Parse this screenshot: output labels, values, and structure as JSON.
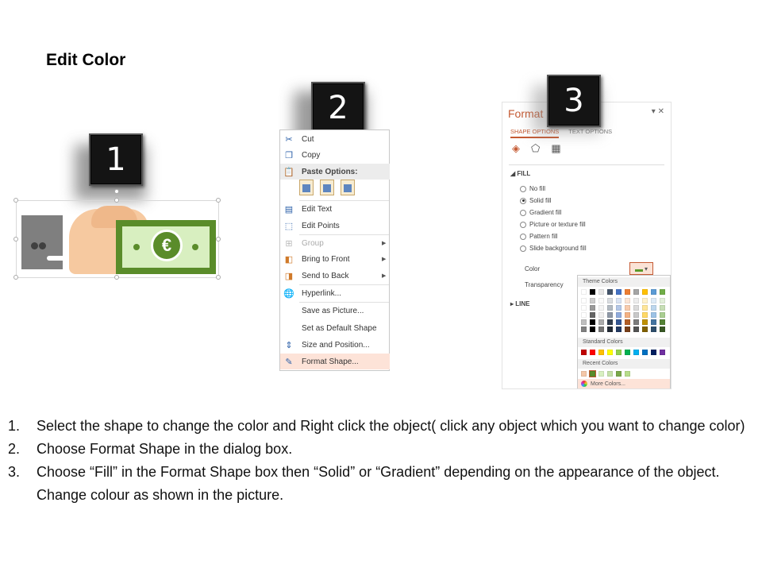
{
  "title": "Edit Color",
  "badges": [
    "1",
    "2",
    "3"
  ],
  "panel1": {
    "currency_symbol": "€"
  },
  "context_menu": {
    "items": [
      {
        "label": "Cut",
        "icon": "scissors-icon"
      },
      {
        "label": "Copy",
        "icon": "copy-icon"
      },
      {
        "label": "Paste Options:",
        "icon": "paste-icon"
      },
      {
        "label": "Edit Text",
        "icon": "edit-text-icon"
      },
      {
        "label": "Edit Points",
        "icon": "edit-points-icon"
      },
      {
        "label": "Group",
        "icon": "group-icon"
      },
      {
        "label": "Bring to Front",
        "icon": "bring-front-icon"
      },
      {
        "label": "Send to Back",
        "icon": "send-back-icon"
      },
      {
        "label": "Hyperlink...",
        "icon": "globe-link-icon"
      },
      {
        "label": "Save as Picture...",
        "icon": ""
      },
      {
        "label": "Set as Default Shape",
        "icon": ""
      },
      {
        "label": "Size and Position...",
        "icon": "size-position-icon"
      },
      {
        "label": "Format Shape...",
        "icon": "format-shape-icon"
      }
    ]
  },
  "format_pane": {
    "title": "Format",
    "tab_active": "SHAPE OPTIONS",
    "tab_other": "TEXT OPTIONS",
    "fill_section": "FILL",
    "fill_options": [
      "No fill",
      "Solid fill",
      "Gradient fill",
      "Picture or texture fill",
      "Pattern fill",
      "Slide background fill"
    ],
    "selected_fill": "Solid fill",
    "color_label": "Color",
    "transparency_label": "Transparency",
    "line_section": "LINE"
  },
  "color_dropdown": {
    "theme_header": "Theme Colors",
    "standard_header": "Standard Colors",
    "recent_header": "Recent Colors",
    "more_label": "More Colors...",
    "theme_top": [
      "#ffffff",
      "#000000",
      "#e7e6e6",
      "#44546a",
      "#4472c4",
      "#ed7d31",
      "#a5a5a5",
      "#ffc000",
      "#5b9bd5",
      "#70ad47"
    ],
    "standard": [
      "#c00000",
      "#ff0000",
      "#ffc000",
      "#ffff00",
      "#92d050",
      "#00b050",
      "#00b0f0",
      "#0070c0",
      "#002060",
      "#7030a0"
    ],
    "recent": [
      "#f4c7a8",
      "#5a8c2a",
      "#d8efc0",
      "#c5e0a8",
      "#7aa84a",
      "#b7dd8a"
    ]
  },
  "instructions": [
    {
      "num": "1.",
      "text": "Select the shape to change the color and Right click the object( click any object which you want to change color)"
    },
    {
      "num": "2.",
      "text": "Choose Format Shape in the dialog box."
    },
    {
      "num": "3.",
      "text": "Choose “Fill” in the Format Shape box then “Solid” or “Gradient” depending on the appearance of the object. Change colour as shown in the picture."
    }
  ]
}
